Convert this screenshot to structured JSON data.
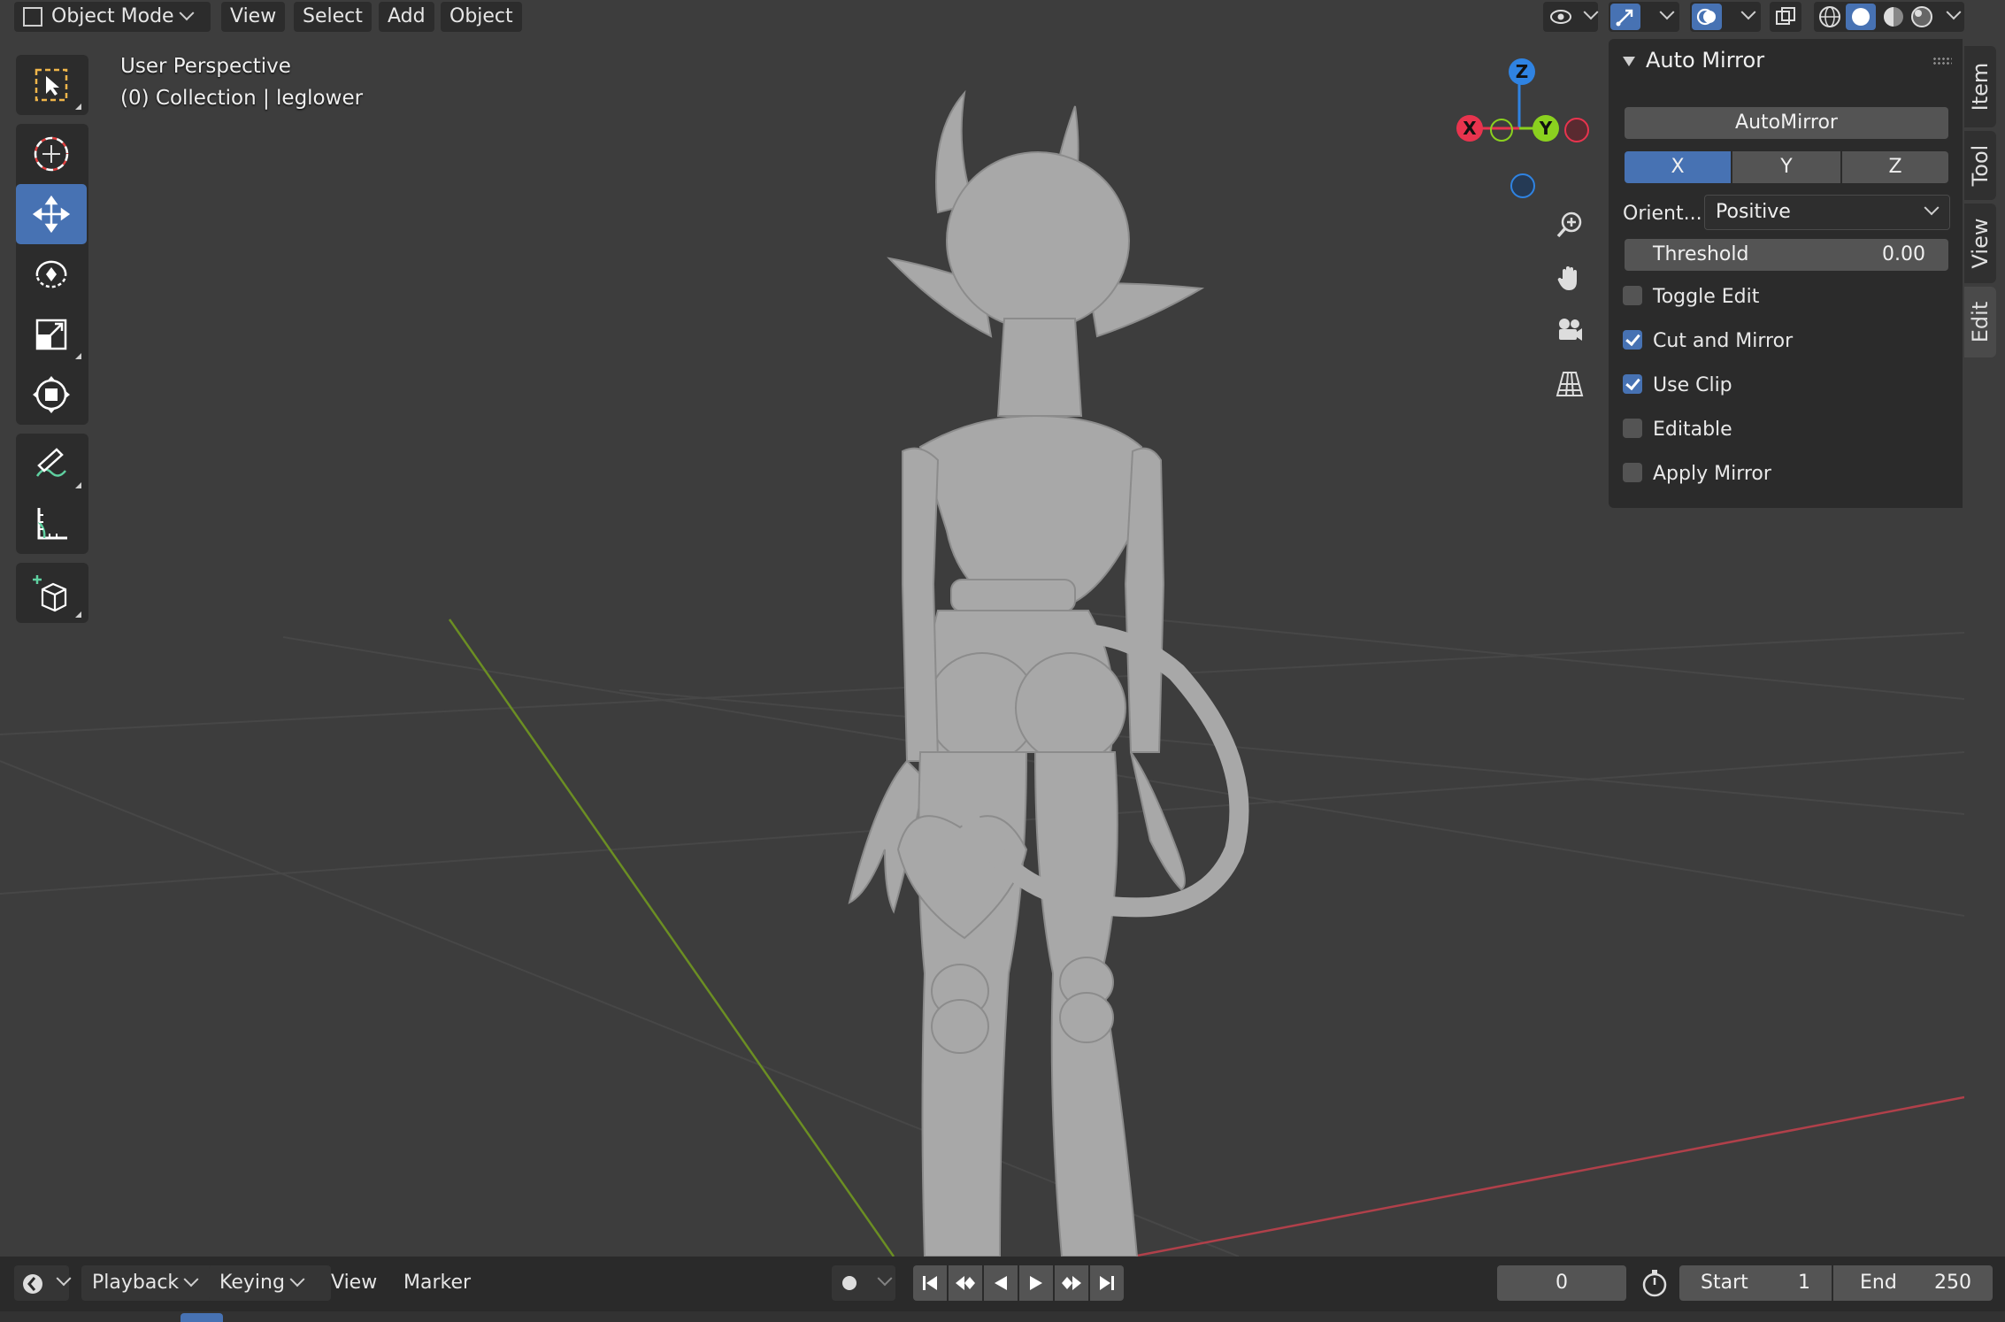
{
  "header": {
    "mode_label": "Object Mode",
    "menus": [
      "View",
      "Select",
      "Add",
      "Object"
    ]
  },
  "viewport": {
    "view_name": "User Perspective",
    "collection_info": "(0) Collection | leglower"
  },
  "gizmo": {
    "axes": [
      "X",
      "Y",
      "Z"
    ],
    "colors": {
      "x": "#e8344e",
      "y": "#8bd11f",
      "z": "#2f83e2"
    }
  },
  "side_tabs": [
    "Item",
    "Tool",
    "View",
    "Edit"
  ],
  "panel": {
    "title": "Auto Mirror",
    "automirror_button": "AutoMirror",
    "axis_buttons": [
      "X",
      "Y",
      "Z"
    ],
    "selected_axis": "X",
    "orient_label": "Orient...",
    "orient_value": "Positive",
    "threshold_label": "Threshold",
    "threshold_value": "0.00",
    "checkboxes": [
      {
        "label": "Toggle Edit",
        "checked": false
      },
      {
        "label": "Cut and Mirror",
        "checked": true
      },
      {
        "label": "Use Clip",
        "checked": true
      },
      {
        "label": "Editable",
        "checked": false
      },
      {
        "label": "Apply Mirror",
        "checked": false
      }
    ]
  },
  "timeline": {
    "menus": [
      "Playback",
      "Keying",
      "View",
      "Marker"
    ],
    "current_frame": "0",
    "start_label": "Start",
    "start_value": "1",
    "end_label": "End",
    "end_value": "250"
  },
  "colors": {
    "accent": "#4772b3",
    "viewport_bg": "#3d3d3d",
    "panel_bg": "#2b2b2b"
  }
}
